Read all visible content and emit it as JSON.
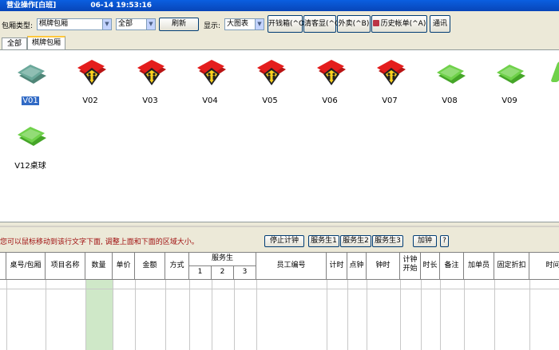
{
  "window": {
    "title": "营业操作[白班]",
    "datetime": "06-14  19:53:16"
  },
  "toolbar": {
    "room_type_label": "包厢类型:",
    "room_type_value": "棋牌包厢",
    "filter_value": "全部",
    "refresh_label": "刷新",
    "display_label": "显示:",
    "display_value": "大图表",
    "open_drawer_label": "开钱箱(^O)",
    "customer_display_label": "清客显(^C)",
    "takeout_label": "外卖(^B)",
    "history_label": "历史帐单(^A)",
    "comm_label": "通讯"
  },
  "tabs": [
    {
      "label": "全部",
      "active": false
    },
    {
      "label": "棋牌包厢",
      "active": true
    }
  ],
  "rooms": [
    {
      "name": "V01",
      "status": "vacant-teal",
      "selected": true
    },
    {
      "name": "V02",
      "status": "occupied"
    },
    {
      "name": "V03",
      "status": "occupied"
    },
    {
      "name": "V04",
      "status": "occupied"
    },
    {
      "name": "V05",
      "status": "occupied"
    },
    {
      "name": "V06",
      "status": "occupied"
    },
    {
      "name": "V07",
      "status": "occupied"
    },
    {
      "name": "V08",
      "status": "vacant"
    },
    {
      "name": "V09",
      "status": "vacant"
    },
    {
      "name": "V12桌球",
      "status": "vacant"
    }
  ],
  "hint": {
    "text": "您可以鼠标移动到该行文字下面, 调整上面和下面的区域大小。"
  },
  "service_buttons": {
    "stop_timer": "停止计钟",
    "waiter1": "服务生1",
    "waiter2": "服务生2",
    "waiter3": "服务生3",
    "add_clock": "加钟",
    "help": "?"
  },
  "grid": {
    "columns": {
      "table_room": "桌号/包厢",
      "item_name": "项目名称",
      "quantity": "数量",
      "unit_price": "单价",
      "amount": "金额",
      "method": "方式",
      "waiter": "服务生",
      "waiter_1": "1",
      "waiter_2": "2",
      "waiter_3": "3",
      "employee_no": "员工编号",
      "timing": "计时",
      "point_clock": "点钟",
      "clock_time": "钟时",
      "timer_start": "计钟开始",
      "duration": "时长",
      "note": "备注",
      "add_by": "加单员",
      "fixed_discount": "固定折扣",
      "time": "时间"
    }
  },
  "colors": {
    "title_bar": "#0a5fe0",
    "occupied_red": "#e41d1d",
    "occupied_badge": "#ffd21e",
    "vacant_green": "#6fd14a",
    "vacant_teal": "#6aa89a",
    "hint_text": "#a01010",
    "qty_column": "#cfe8c8"
  }
}
